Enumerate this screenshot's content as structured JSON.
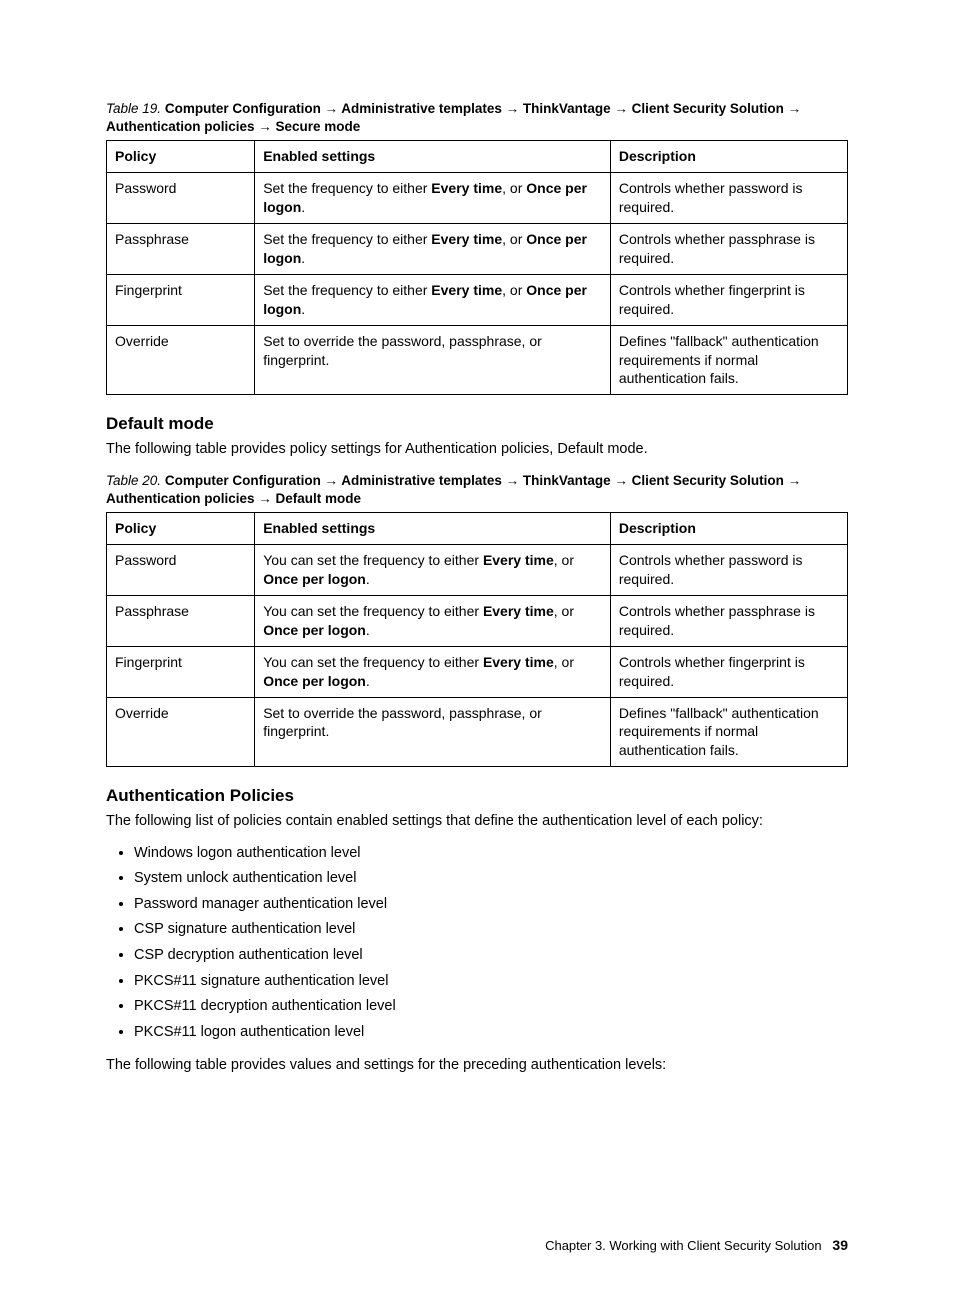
{
  "table19": {
    "caption_prefix": "Table 19.",
    "caption_path": "Computer Configuration → Administrative templates → ThinkVantage → Client Security Solution → Authentication policies → Secure mode",
    "headers": [
      "Policy",
      "Enabled settings",
      "Description"
    ],
    "rows": [
      {
        "policy": "Password",
        "settings_pre": "Set the frequency to either ",
        "settings_b1": "Every time",
        "settings_mid": ", or ",
        "settings_b2": "Once per logon",
        "settings_post": ".",
        "desc": "Controls whether password is required."
      },
      {
        "policy": "Passphrase",
        "settings_pre": "Set the frequency to either ",
        "settings_b1": "Every time",
        "settings_mid": ", or ",
        "settings_b2": "Once per logon",
        "settings_post": ".",
        "desc": "Controls whether passphrase is required."
      },
      {
        "policy": "Fingerprint",
        "settings_pre": "Set the frequency to either ",
        "settings_b1": "Every time",
        "settings_mid": ", or ",
        "settings_b2": "Once per logon",
        "settings_post": ".",
        "desc": "Controls whether fingerprint is required."
      },
      {
        "policy": "Override",
        "settings_plain": "Set to override the password, passphrase, or fingerprint.",
        "desc": "Defines \"fallback\" authentication requirements if normal authentication fails."
      }
    ]
  },
  "section_default": {
    "heading": "Default mode",
    "intro": "The following table provides policy settings for Authentication policies, Default mode."
  },
  "table20": {
    "caption_prefix": "Table 20.",
    "caption_path": "Computer Configuration → Administrative templates → ThinkVantage → Client Security Solution → Authentication policies → Default mode",
    "headers": [
      "Policy",
      "Enabled settings",
      "Description"
    ],
    "rows": [
      {
        "policy": "Password",
        "settings_pre": "You can set the frequency to either ",
        "settings_b1": "Every time",
        "settings_mid": ", or ",
        "settings_b2": "Once per logon",
        "settings_post": ".",
        "desc": "Controls whether password is required."
      },
      {
        "policy": "Passphrase",
        "settings_pre": "You can set the frequency to either ",
        "settings_b1": "Every time",
        "settings_mid": ", or ",
        "settings_b2": "Once per logon",
        "settings_post": ".",
        "desc": "Controls whether passphrase is required."
      },
      {
        "policy": "Fingerprint",
        "settings_pre": "You can set the frequency to either ",
        "settings_b1": "Every time",
        "settings_mid": ", or ",
        "settings_b2": "Once per logon",
        "settings_post": ".",
        "desc": "Controls whether fingerprint is required."
      },
      {
        "policy": "Override",
        "settings_plain": "Set to override the password, passphrase, or fingerprint.",
        "desc": "Defines \"fallback\" authentication requirements if normal authentication fails."
      }
    ]
  },
  "section_auth": {
    "heading": "Authentication Policies",
    "intro": "The following list of policies contain enabled settings that define the authentication level of each policy:",
    "items": [
      "Windows logon authentication level",
      "System unlock authentication level",
      "Password manager authentication level",
      "CSP signature authentication level",
      "CSP decryption authentication level",
      "PKCS#11 signature authentication level",
      "PKCS#11 decryption authentication level",
      "PKCS#11 logon authentication level"
    ],
    "outro": "The following table provides values and settings for the preceding authentication levels:"
  },
  "footer": {
    "chapter": "Chapter 3. Working with Client Security Solution",
    "page": "39"
  }
}
